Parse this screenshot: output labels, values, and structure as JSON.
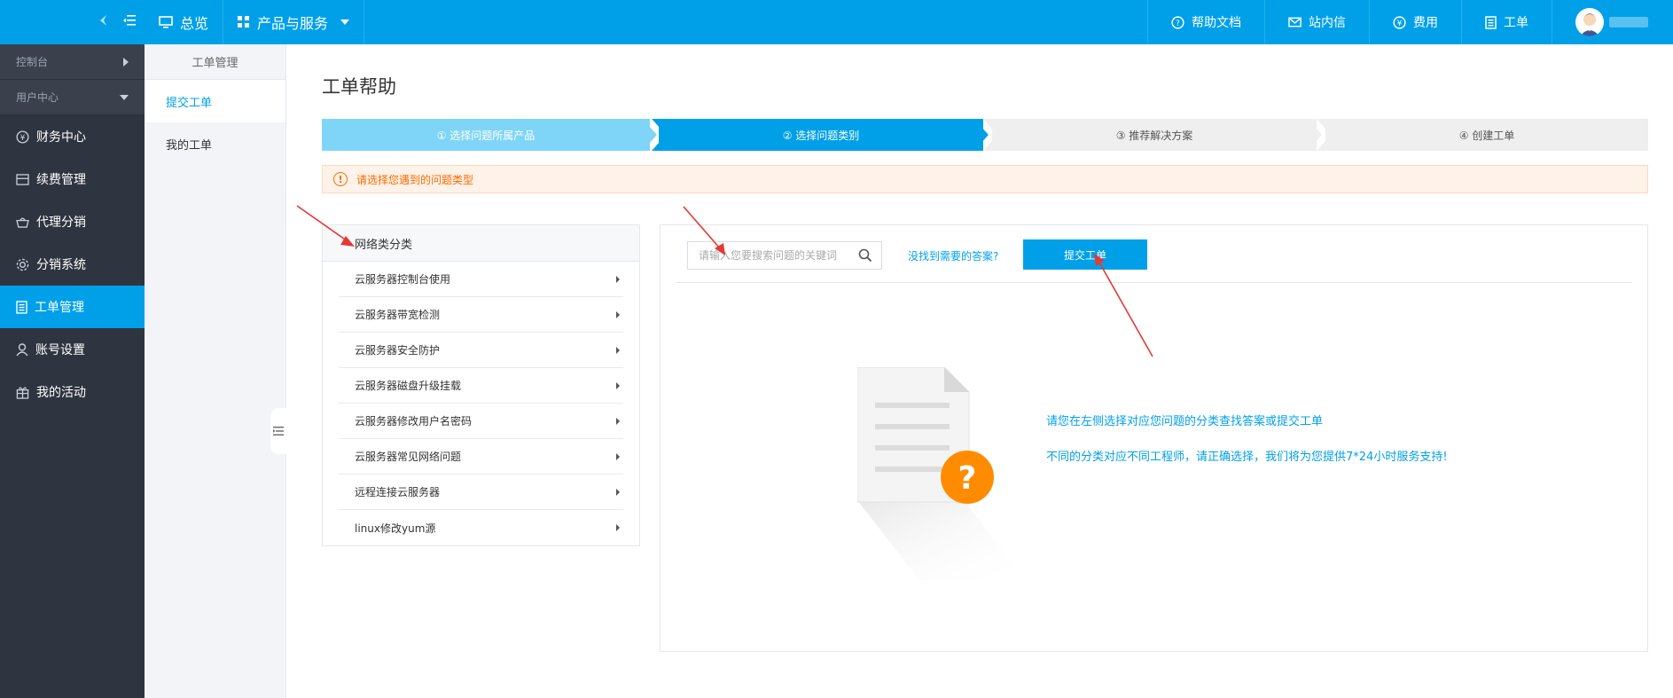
{
  "topbar": {
    "overview_label": "总览",
    "products_label": "产品与服务",
    "help_docs_label": "帮助文档",
    "messages_label": "站内信",
    "fees_label": "费用",
    "tickets_label": "工单"
  },
  "sidebar": {
    "group_console": "控制台",
    "group_user_center": "用户中心",
    "items": [
      {
        "label": "财务中心",
        "icon": "yen-circle-icon"
      },
      {
        "label": "续费管理",
        "icon": "renew-icon"
      },
      {
        "label": "代理分销",
        "icon": "basket-icon"
      },
      {
        "label": "分销系统",
        "icon": "gear-icon"
      },
      {
        "label": "工单管理",
        "icon": "document-icon"
      },
      {
        "label": "账号设置",
        "icon": "user-icon"
      },
      {
        "label": "我的活动",
        "icon": "gift-icon"
      }
    ],
    "active_index": 4
  },
  "subnav": {
    "title": "工单管理",
    "items": [
      "提交工单",
      "我的工单"
    ]
  },
  "main": {
    "title": "工单帮助",
    "steps": [
      "① 选择问题所属产品",
      "② 选择问题类别",
      "③ 推荐解决方案",
      "④ 创建工单"
    ],
    "alert": "请选择您遇到的问题类型",
    "category": {
      "title": "网络类分类",
      "items": [
        "云服务器控制台使用",
        "云服务器带宽检测",
        "云服务器安全防护",
        "云服务器磁盘升级挂载",
        "云服务器修改用户名密码",
        "云服务器常见网络问题",
        "远程连接云服务器",
        "linux修改yum源"
      ]
    },
    "search": {
      "placeholder": "请输入您要搜索问题的关键词",
      "value": ""
    },
    "not_found_link": "没找到需要的答案?",
    "submit_button": "提交工单",
    "info_line1": "请您在左侧选择对应您问题的分类查找答案或提交工单",
    "info_line2": "不同的分类对应不同工程师，请正确选择，我们将为您提供7*24小时服务支持!"
  },
  "colors": {
    "primary": "#00a0e9",
    "sidebar_bg": "#2f3540",
    "alert_text": "#ff6a00",
    "annotation_arrow": "#e53935",
    "question_badge": "#ff8c00"
  }
}
